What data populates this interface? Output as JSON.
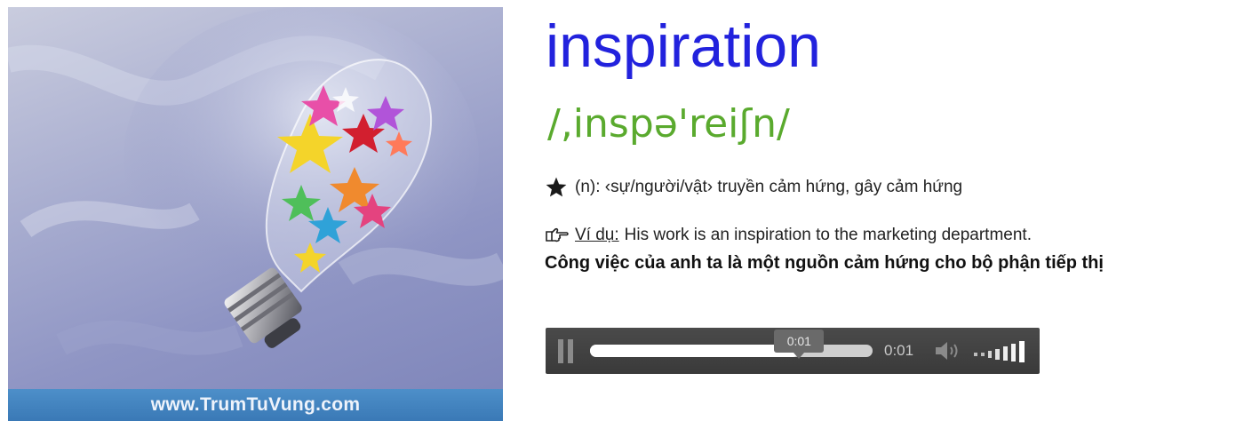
{
  "image": {
    "caption": "www.TrumTuVung.com"
  },
  "entry": {
    "word": "inspiration",
    "phonetic": "/,inspə'reiʃn/",
    "definition": "(n): ‹sự/người/vật› truyền cảm hứng, gây cảm hứng",
    "example_label": "Ví dụ:",
    "example_text": "His work is an inspiration to the marketing department.",
    "translation": "Công việc của anh ta là một nguồn cảm hứng cho bộ phận tiếp thị"
  },
  "player": {
    "tooltip_time": "0:01",
    "current_time": "0:01",
    "progress": 0.74,
    "volume_level": 1.0
  },
  "icons": {
    "definition": "star-icon",
    "example": "pointing-hand-icon",
    "pause": "pause-icon",
    "volume": "speaker-icon"
  },
  "colors": {
    "word": "#2222dd",
    "phonetic": "#5aaa2e",
    "caption_bar": "#3a79b6",
    "player_bg": "#3a3a3a"
  }
}
